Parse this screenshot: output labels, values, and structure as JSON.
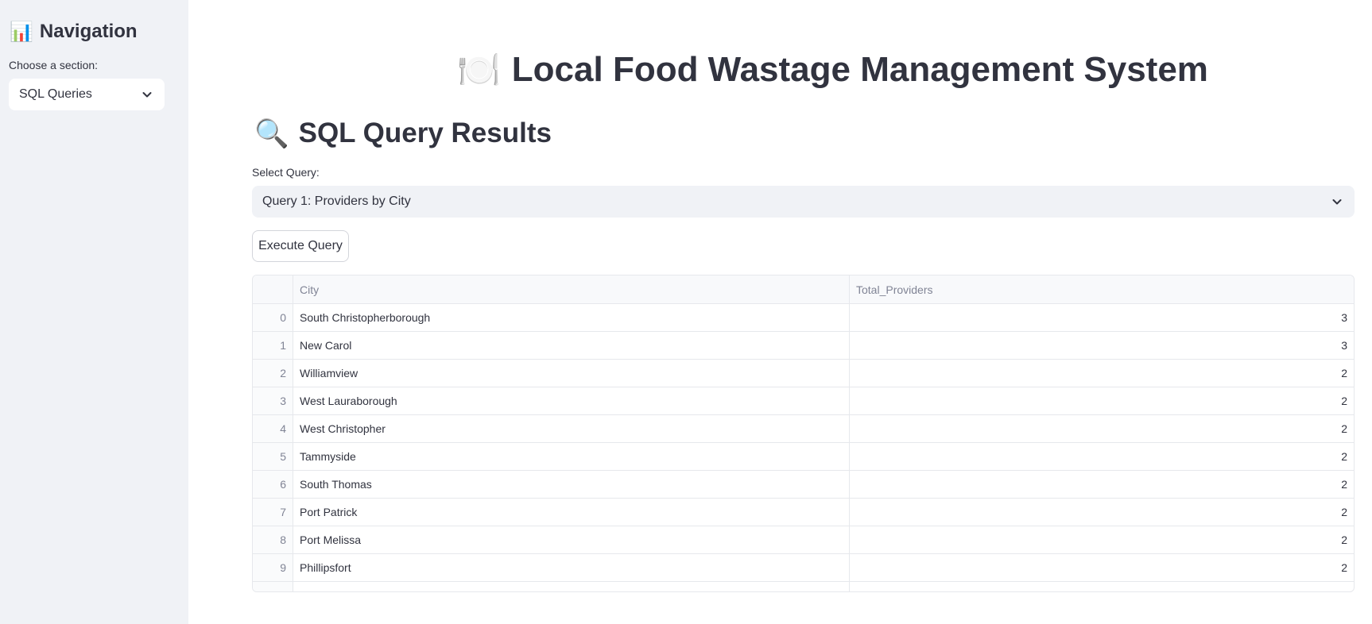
{
  "sidebar": {
    "title_icon": "📊",
    "title": "Navigation",
    "choose_label": "Choose a section:",
    "selected_section": "SQL Queries"
  },
  "main": {
    "title_icon": "🍽️",
    "title": "Local Food Wastage Management System",
    "section_icon": "🔍",
    "section_title": "SQL Query Results",
    "query_label": "Select Query:",
    "selected_query": "Query 1: Providers by City",
    "execute_label": "Execute Query"
  },
  "table": {
    "columns": [
      "",
      "City",
      "Total_Providers"
    ],
    "rows": [
      {
        "index": "0",
        "city": "South Christopherborough",
        "total": "3"
      },
      {
        "index": "1",
        "city": "New Carol",
        "total": "3"
      },
      {
        "index": "2",
        "city": "Williamview",
        "total": "2"
      },
      {
        "index": "3",
        "city": "West Lauraborough",
        "total": "2"
      },
      {
        "index": "4",
        "city": "West Christopher",
        "total": "2"
      },
      {
        "index": "5",
        "city": "Tammyside",
        "total": "2"
      },
      {
        "index": "6",
        "city": "South Thomas",
        "total": "2"
      },
      {
        "index": "7",
        "city": "Port Patrick",
        "total": "2"
      },
      {
        "index": "8",
        "city": "Port Melissa",
        "total": "2"
      },
      {
        "index": "9",
        "city": "Phillipsfort",
        "total": "2"
      }
    ]
  },
  "icons": {
    "select_chevron": "chevron-down-icon"
  }
}
